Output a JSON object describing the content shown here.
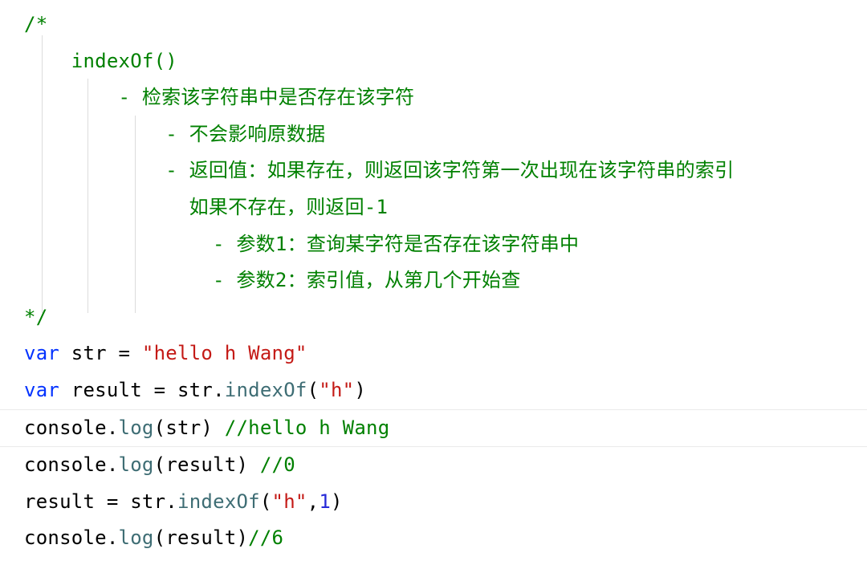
{
  "code": {
    "comment": {
      "open": "/*",
      "l_method": "indexOf()",
      "l_desc": "- 检索该字符串中是否存在该字符",
      "l_desc2": "- 不会影响原数据",
      "l_return": "- 返回值：如果存在，则返回该字符第一次出现在该字符串的索引",
      "l_return2": "  如果不存在，则返回-1",
      "l_param1": "- 参数1：查询某字符是否存在该字符串中",
      "l_param2": "- 参数2：索引值，从第几个开始查",
      "close": "*/"
    },
    "kw_var1": "var",
    "id_str": " str ",
    "op_eq1": "= ",
    "str_lit": "\"hello h Wang\"",
    "kw_var2": "var",
    "id_result": " result ",
    "op_eq2": "= ",
    "id_str2": "str",
    "dot1": ".",
    "m_indexof1": "indexOf",
    "paren_o1": "(",
    "arg_h1": "\"h\"",
    "paren_c1": ")",
    "id_console1": "console",
    "dot2": ".",
    "m_log1": "log",
    "paren_o2": "(",
    "arg_str3": "str",
    "paren_c2": ") ",
    "cm_out1": "//hello h Wang",
    "id_console2": "console",
    "dot3": ".",
    "m_log2": "log",
    "paren_o3": "(",
    "arg_res1": "result",
    "paren_c3": ") ",
    "cm_out2": "//0",
    "id_res_assign": "result ",
    "op_eq3": "= ",
    "id_str3": "str",
    "dot4": ".",
    "m_indexof2": "indexOf",
    "paren_o4": "(",
    "arg_h2": "\"h\"",
    "comma": ",",
    "arg_1": "1",
    "paren_c4": ")",
    "id_console3": "console",
    "dot5": ".",
    "m_log3": "log",
    "paren_o5": "(",
    "arg_res2": "result",
    "paren_c5": ")",
    "cm_out3": "//6"
  },
  "indent": {
    "i1": "    ",
    "i2": "        ",
    "i3": "            ",
    "i4": "                "
  }
}
